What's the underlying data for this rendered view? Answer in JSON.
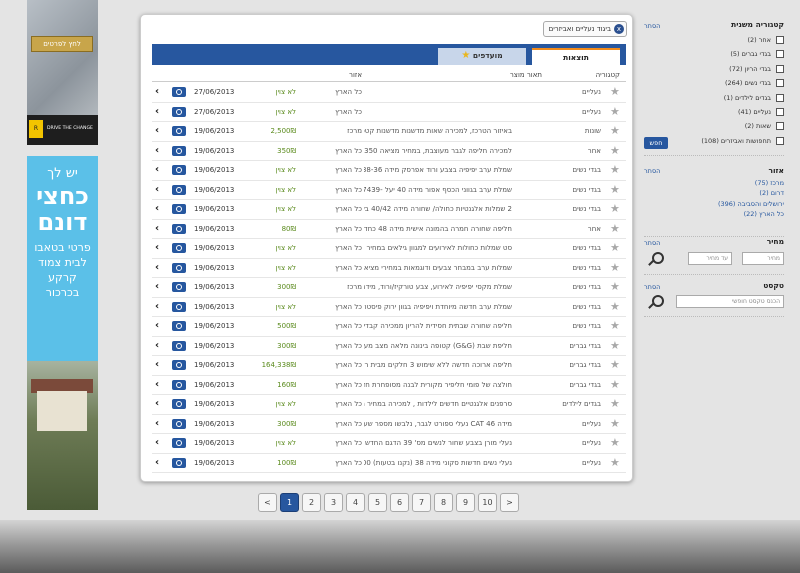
{
  "ads": {
    "top": {
      "button": "לחץ לפרטים",
      "slogan": "DRIVE THE CHANGE",
      "logo": "R"
    },
    "bottom": {
      "line1": "יש לך",
      "line2": "כחצי",
      "line3": "דונם",
      "line4": "פרטי בטאבו",
      "line5": "לבית צמוד",
      "line6": "קרקע",
      "line7": "בכרכור"
    }
  },
  "chip": {
    "label": "ביגוד נעליים ואביזרים",
    "close": "x"
  },
  "tabs": {
    "results": "תוצאות",
    "favorites": "מועדפים"
  },
  "columns": {
    "category": "קטגוריה",
    "description": "תאור מוצר",
    "area": "אזור"
  },
  "rows": [
    {
      "cat": "נעליים",
      "desc": "",
      "area": "כל הארץ",
      "price": "לא צוין",
      "date": "27/06/2013"
    },
    {
      "cat": "נעליים",
      "desc": "",
      "area": "כל הארץ",
      "price": "לא צוין",
      "date": "27/06/2013"
    },
    {
      "cat": "שונות",
      "desc": "באיזור הטרכז, למכירה שאות מדשנות מדשנות קטסט...",
      "area": "מרכז",
      "price": "2,500₪",
      "date": "19/06/2013"
    },
    {
      "cat": "אחר",
      "desc": "למכירה חליפה לגבר מעוצבת, במחיר מציאה 350 ש...",
      "area": "כל הארץ",
      "price": "350₪",
      "date": "19/06/2013"
    },
    {
      "cat": "בגדי נשים",
      "desc": "שמלת ערב יפיפיה בצבע ורוד אפרסק מידה 38-36 ...",
      "area": "כל הארץ",
      "price": "לא צוין",
      "date": "19/06/2013"
    },
    {
      "cat": "בגדי נשים",
      "desc": "שמלת ערב בגווני הכסף אפור מידה 40 יעל -17439...",
      "area": "כל הארץ",
      "price": "לא צוין",
      "date": "19/06/2013"
    },
    {
      "cat": "בגדי נשים",
      "desc": "2 שמלות אלגנטיות כחולה/ שחורה מידה 40/42 בשי...",
      "area": "כל הארץ",
      "price": "לא צוין",
      "date": "19/06/2013"
    },
    {
      "cat": "אחר",
      "desc": "חליפה שחורה חמרה בהמונה אישית מידה 48 כחד...",
      "area": "כל הארץ",
      "price": "80₪",
      "date": "19/06/2013"
    },
    {
      "cat": "בגדי נשים",
      "desc": "סט שמלות כחולות לאירועים למגוון גילאים במחיר מצי...",
      "area": "כל הארץ",
      "price": "לא צוין",
      "date": "19/06/2013"
    },
    {
      "cat": "בגדי נשים",
      "desc": "שמלות ערב במבחר צבעים ודוגמאות במחירי מציאה ...",
      "area": "כל הארץ",
      "price": "לא צוין",
      "date": "19/06/2013"
    },
    {
      "cat": "בגדי נשים",
      "desc": "שמלת מקסי יפיפיה לאירוע, צבע טורקיז/ורוד, מידה 3...",
      "area": "מרכז",
      "price": "300₪",
      "date": "19/06/2013"
    },
    {
      "cat": "בגדי נשים",
      "desc": "שמלת ערב חדשה מיוחדת ויפיפיה בגוון ירוק פיסטוק,...",
      "area": "כל הארץ",
      "price": "לא צוין",
      "date": "19/06/2013"
    },
    {
      "cat": "בגדי נשים",
      "desc": "חליפה שחורה שבתית חסידית להריון ממכירה קבדית ...",
      "area": "כל הארץ",
      "price": "500₪",
      "date": "19/06/2013"
    },
    {
      "cat": "בגדי גברים",
      "desc": "חליפת שבת (G&G) קטופה בינונה מלאה מצב מעולן...",
      "area": "כל הארץ",
      "price": "300₪",
      "date": "19/06/2013"
    },
    {
      "cat": "בגדי גברים",
      "desc": "חליפה ארוכה חדשה ללא שימוש 3 חלקים מבית רויא...",
      "area": "כל הארץ",
      "price": "164,338₪",
      "date": "19/06/2013"
    },
    {
      "cat": "בגדי גברים",
      "desc": "חולצה של פומי חליפיר מקורית לבנה מסופחרת חד...",
      "area": "כל הארץ",
      "price": "160₪",
      "date": "19/06/2013"
    },
    {
      "cat": "בגדים לילדים",
      "desc": "סרפנים אלגנטיים חדשים לילדות , למכירה במחיר מצ...",
      "area": "כל הארץ",
      "price": "לא צוין",
      "date": "19/06/2013"
    },
    {
      "cat": "נעליים",
      "desc": "מידה 46 CAT נעלי ספורט לגבר, נלבשו מספר שעו...",
      "area": "כל הארץ",
      "price": "300₪",
      "date": "19/06/2013"
    },
    {
      "cat": "נעליים",
      "desc": "נעלי מורן בצבע שחור לנשים מס' 39 הדגם החדש 0...",
      "area": "כל הארץ",
      "price": "לא צוין",
      "date": "19/06/2013"
    },
    {
      "cat": "נעליים",
      "desc": "נעלי נשים חדשות סקוני מידה 38 (נקנו בטעות) 100 ...",
      "area": "כל הארץ",
      "price": "100₪",
      "date": "19/06/2013"
    }
  ],
  "pagination": {
    "prev": "<",
    "pages": [
      "1",
      "2",
      "3",
      "4",
      "5",
      "6",
      "7",
      "8",
      "9",
      "10"
    ],
    "next": ">",
    "current": "1"
  },
  "filters": {
    "subcategory": {
      "title": "קטגוריה משנית",
      "clear": "הסתר",
      "items": [
        "אחר (2)",
        "בגדי גברים (5)",
        "בגדי הריון (72)",
        "בגדי נשים (264)",
        "בגדים לילדים (1)",
        "נעליים (41)",
        "שאות (2)",
        "תחפושות ואביזרים (108)"
      ],
      "button": "חפש"
    },
    "area": {
      "title": "אזור",
      "clear": "הסתר",
      "items": [
        "מרכז (75)",
        "דרום (2)",
        "ירושלים והסביבה (396)",
        "כל הארץ (22)"
      ]
    },
    "price": {
      "title": "מחיר",
      "clear": "הסתר",
      "from": "מחיר",
      "to": "עד מחיר"
    },
    "text": {
      "title": "טקסט",
      "clear": "הסתר",
      "placeholder": "הכנס טקסט חופשי"
    }
  }
}
